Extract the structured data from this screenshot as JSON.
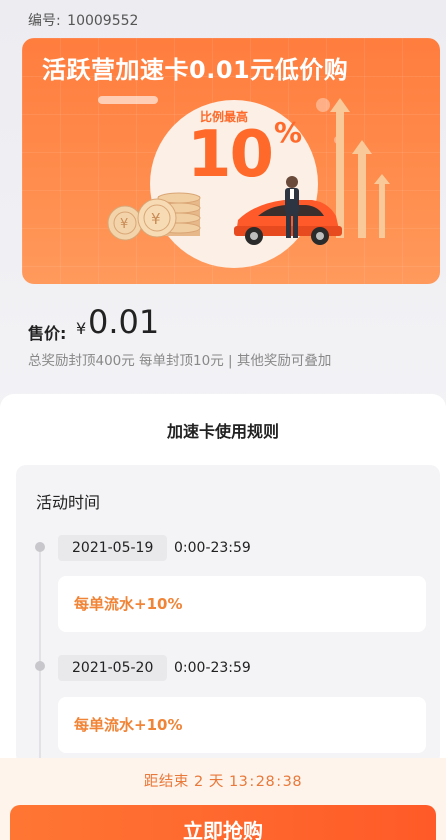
{
  "header": {
    "code_label": "编号:",
    "code_value": "10009552"
  },
  "banner": {
    "title": "活跃营加速卡0.01元低价购",
    "ratio_label": "比例最高",
    "percent_number": "10",
    "percent_sign": "%",
    "colors": {
      "bg": "#ff7d3e",
      "accent": "#ff6a2a"
    }
  },
  "price": {
    "label": "售价:",
    "currency": "¥",
    "value": "0.01",
    "note": "总奖励封顶400元 每单封顶10元 | 其他奖励可叠加"
  },
  "rules": {
    "title": "加速卡使用规则",
    "section_label": "活动时间",
    "entries": [
      {
        "date": "2021-05-19",
        "time": "0:00-23:59",
        "reward": "每单流水+10%"
      },
      {
        "date": "2021-05-20",
        "time": "0:00-23:59",
        "reward": "每单流水+10%"
      }
    ]
  },
  "footer": {
    "countdown_prefix": "距结束",
    "days": "2",
    "days_unit": "天",
    "hours": "13",
    "minutes": "28",
    "seconds": "38",
    "separator": ":",
    "buy_label": "立即抢购",
    "accent_color": "#ff5a28"
  },
  "icons": [
    "coin-stack-icon",
    "car-icon",
    "businessman-icon",
    "up-arrow-icon"
  ]
}
